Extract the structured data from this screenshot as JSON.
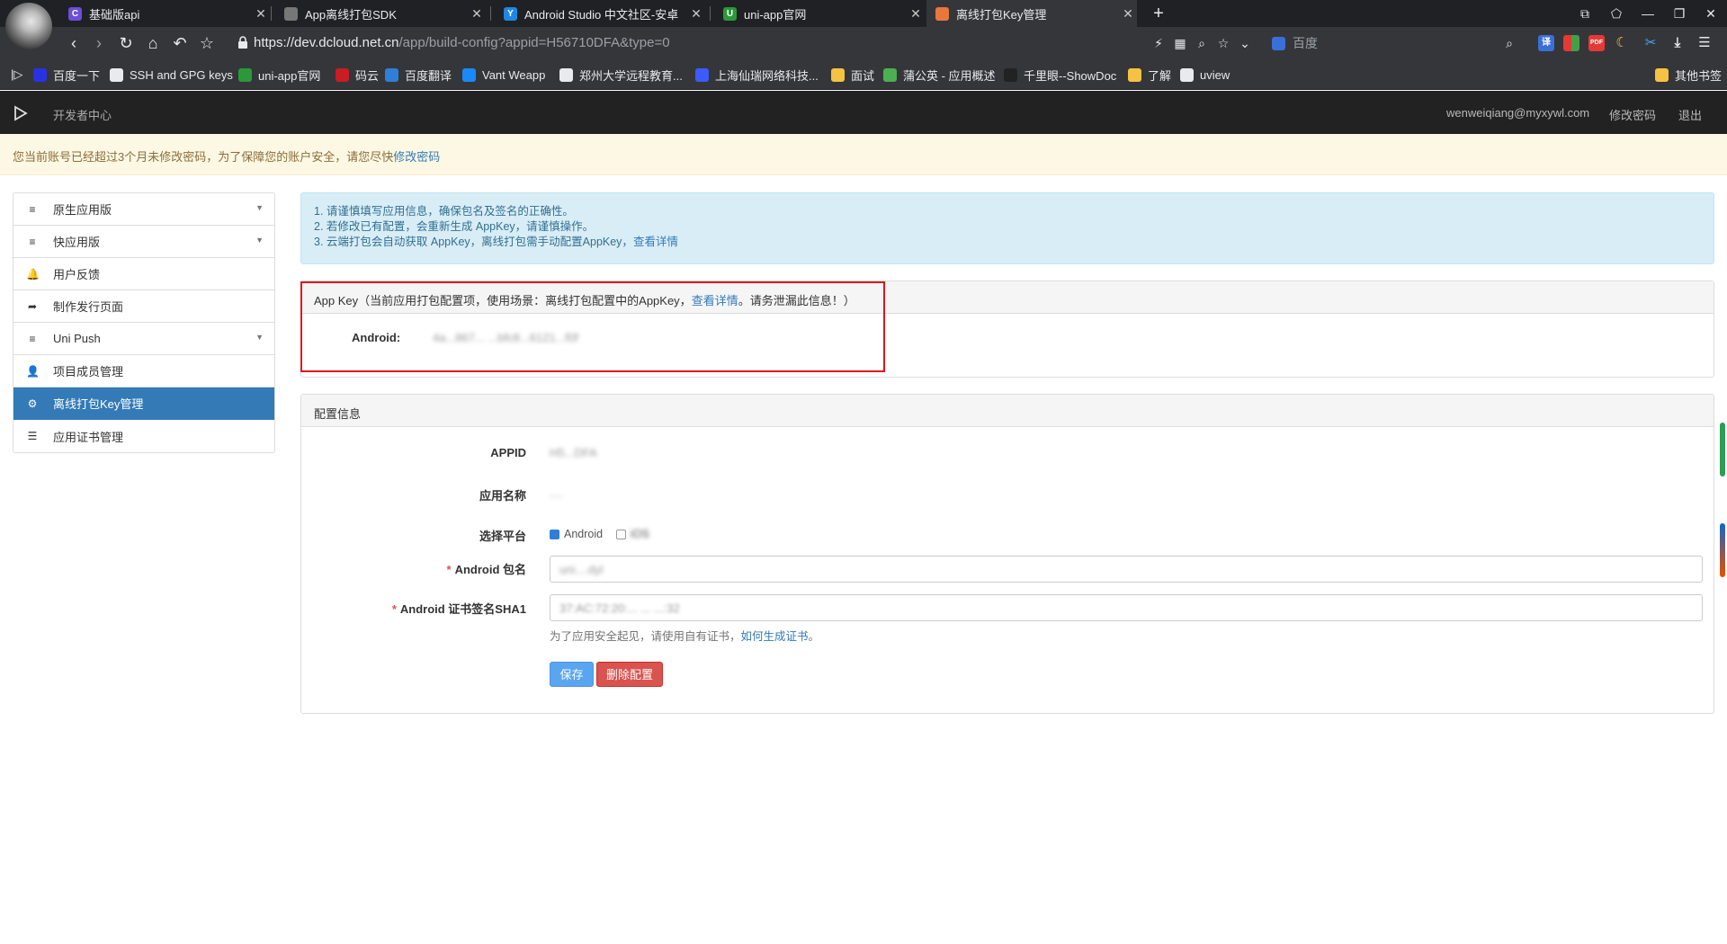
{
  "browser": {
    "tabs": [
      {
        "title": "基础版api",
        "icon_color": "#6b4fd8",
        "icon_char": "C",
        "active": false
      },
      {
        "title": "App离线打包SDK",
        "icon_color": "#777777",
        "icon_char": "",
        "active": false
      },
      {
        "title": "Android Studio 中文社区-安卓",
        "icon_color": "#1e88e5",
        "icon_char": "Y",
        "active": false
      },
      {
        "title": "uni-app官网",
        "icon_color": "#2b9939",
        "icon_char": "U",
        "active": false
      },
      {
        "title": "离线打包Key管理",
        "icon_color": "#e8773b",
        "icon_char": "",
        "active": true
      }
    ],
    "url_host": "https://dev.dcloud.net.cn",
    "url_path": "/app/build-config?appid=H56710DFA&type=0",
    "search_engine": "百度",
    "bookmarks": [
      {
        "label": "百度一下",
        "icon_color": "#2932e1"
      },
      {
        "label": "SSH and GPG keys",
        "icon_color": "#e8eaed"
      },
      {
        "label": "uni-app官网",
        "icon_color": "#2b9939"
      },
      {
        "label": "码云",
        "icon_color": "#c71d23"
      },
      {
        "label": "百度翻译",
        "icon_color": "#2f7fd9"
      },
      {
        "label": "Vant Weapp",
        "icon_color": "#1989fa"
      },
      {
        "label": "郑州大学远程教育...",
        "icon_color": "#e8eaed"
      },
      {
        "label": "上海仙瑞网络科技...",
        "icon_color": "#3d5afe"
      },
      {
        "label": "面试",
        "icon_color": "#f5c242"
      },
      {
        "label": "蒲公英 - 应用概述",
        "icon_color": "#4caf50"
      },
      {
        "label": "千里眼--ShowDoc",
        "icon_color": "#222222"
      },
      {
        "label": "了解",
        "icon_color": "#f5c242"
      },
      {
        "label": "uview",
        "icon_color": "#e8eaed"
      }
    ],
    "other_bookmarks": "其他书签"
  },
  "header": {
    "brand": "开发者中心",
    "email": "wenweiqiang@myxywl.com",
    "change_password": "修改密码",
    "logout": "退出"
  },
  "notice": {
    "text": "您当前账号已经超过3个月未修改密码，为了保障您的账户安全，请您尽快",
    "link": "修改密码"
  },
  "sidebar": {
    "items": [
      {
        "label": "原生应用版",
        "icon": "≡",
        "caret": true,
        "active": false
      },
      {
        "label": "快应用版",
        "icon": "≡",
        "caret": true,
        "active": false
      },
      {
        "label": "用户反馈",
        "icon": "🔔",
        "caret": false,
        "active": false
      },
      {
        "label": "制作发行页面",
        "icon": "➦",
        "caret": false,
        "active": false
      },
      {
        "label": "Uni Push",
        "icon": "≡",
        "caret": true,
        "active": false
      },
      {
        "label": "项目成员管理",
        "icon": "👤",
        "caret": false,
        "active": false
      },
      {
        "label": "离线打包Key管理",
        "icon": "⚙",
        "caret": false,
        "active": true
      },
      {
        "label": "应用证书管理",
        "icon": "☰",
        "caret": false,
        "active": false
      }
    ]
  },
  "info": {
    "line1": "1. 请谨慎填写应用信息，确保包名及签名的正确性。",
    "line2": "2. 若修改已有配置，会重新生成 AppKey，请谨慎操作。",
    "line3": "3. 云端打包会自动获取 AppKey，离线打包需手动配置AppKey，",
    "line3_link": "查看详情"
  },
  "appkey": {
    "heading": "App Key（当前应用打包配置项，使用场景：离线打包配置中的AppKey，",
    "heading_link": "查看详情",
    "heading_tail": "。请务泄漏此信息！）",
    "android_label": "Android:",
    "android_value": "4a...867... ...bfc8...6121...f0f"
  },
  "config": {
    "heading": "配置信息",
    "appid_label": "APPID",
    "appid_value": "H5...DFA",
    "appname_label": "应用名称",
    "appname_value": "....",
    "platform_label": "选择平台",
    "platform_android": "Android",
    "platform_ios": "iOS",
    "package_label": "Android 包名",
    "package_value": "uni....dyl",
    "sha1_label": "Android 证书签名SHA1",
    "sha1_value": "37:AC:72:20:... ... ...:32",
    "help_text": "为了应用安全起见，请使用自有证书，",
    "help_link": "如何生成证书",
    "help_tail": "。",
    "save": "保存",
    "delete": "删除配置"
  }
}
